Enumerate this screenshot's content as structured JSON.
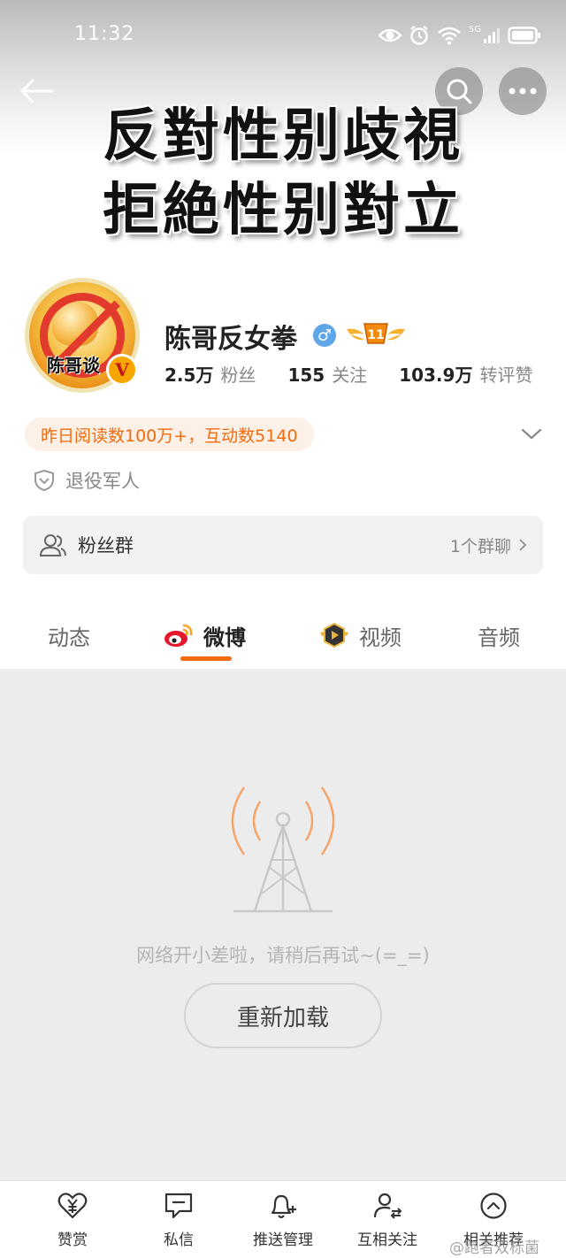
{
  "status_bar": {
    "time": "11:32",
    "network": "5G"
  },
  "header": {
    "banner_line1": "反對性别歧視",
    "banner_line2": "拒絶性别對立"
  },
  "profile": {
    "avatar_text": "陈哥谈",
    "username": "陈哥反女拳",
    "gender_symbol": "♂",
    "level": "11",
    "stats": [
      {
        "value": "2.5万",
        "label": "粉丝"
      },
      {
        "value": "155",
        "label": "关注"
      },
      {
        "value": "103.9万",
        "label": "转评赞"
      }
    ],
    "read_stats": "昨日阅读数100万+，互动数5140",
    "identity_tag": "退役军人"
  },
  "fans_group": {
    "label": "粉丝群",
    "count": "1个群聊"
  },
  "tabs": [
    {
      "label": "动态"
    },
    {
      "label": "微博"
    },
    {
      "label": "视频"
    },
    {
      "label": "音频"
    }
  ],
  "content": {
    "error_message": "网络开小差啦，请稍后再试~(=_=)",
    "reload_label": "重新加载"
  },
  "bottom_nav": [
    {
      "label": "赞赏",
      "icon": "yen-heart-icon"
    },
    {
      "label": "私信",
      "icon": "message-icon"
    },
    {
      "label": "推送管理",
      "icon": "bell-plus-icon"
    },
    {
      "label": "互相关注",
      "icon": "mutual-follow-icon"
    },
    {
      "label": "相关推荐",
      "icon": "chevron-up-circle-icon"
    }
  ],
  "watermark": "@跑者双标菌",
  "colors": {
    "accent": "#f26b0f",
    "pill_bg": "#fdf0e6",
    "gender": "#5ea6e8"
  }
}
